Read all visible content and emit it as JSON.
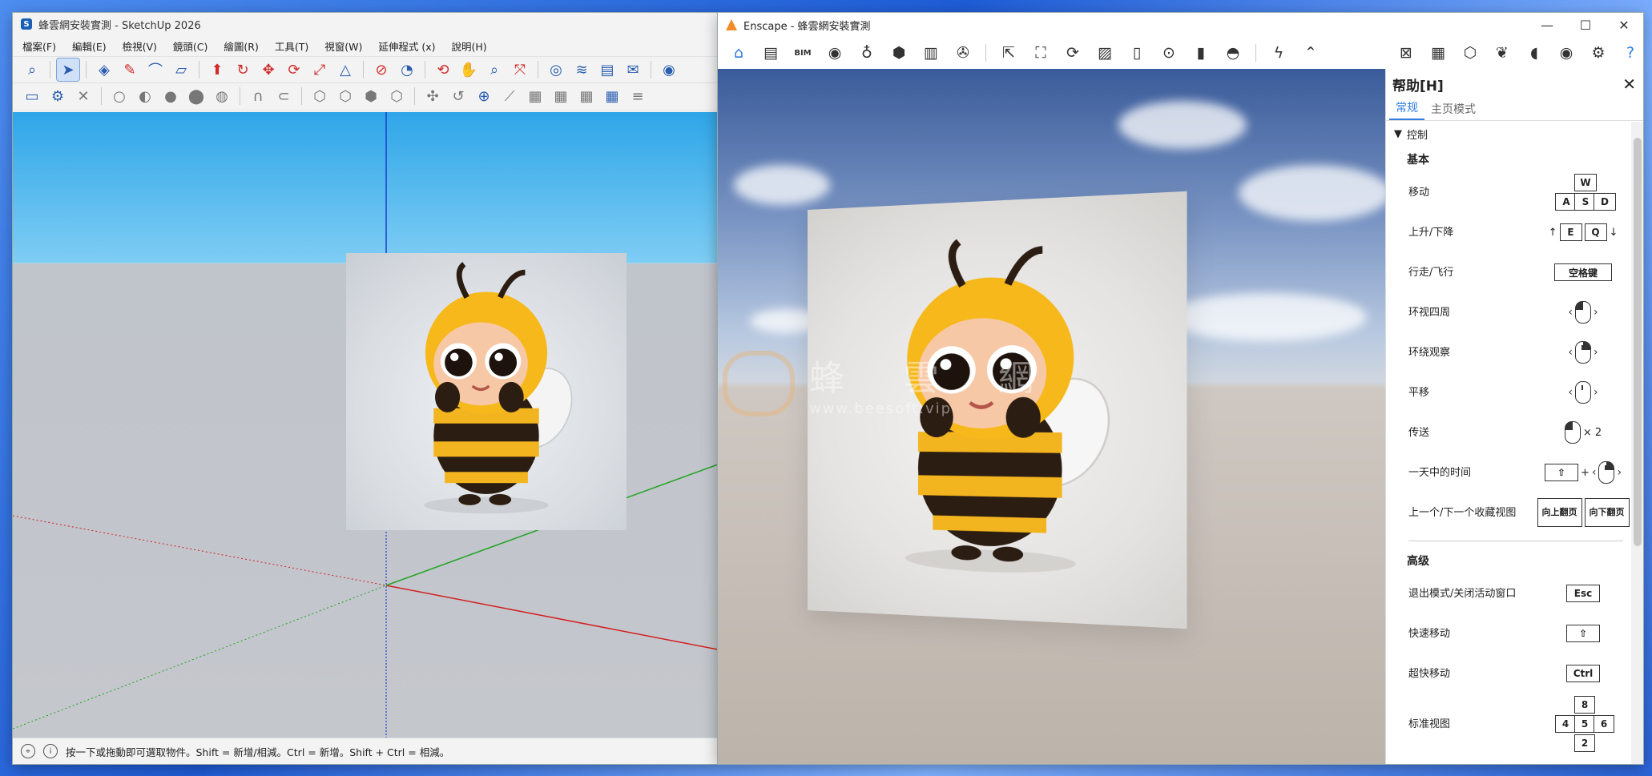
{
  "sketchup": {
    "title": "蜂雲網安裝實測 - SketchUp 2026",
    "menu": [
      "檔案(F)",
      "編輯(E)",
      "檢視(V)",
      "鏡頭(C)",
      "繪圖(R)",
      "工具(T)",
      "視窗(W)",
      "延伸程式 (x)",
      "說明(H)"
    ],
    "status_text": "按一下或拖動即可選取物件。Shift = 新增/相減。Ctrl = 新增。Shift + Ctrl = 相減。",
    "icons": {
      "geo": "location-icon",
      "info": "info-icon"
    }
  },
  "enscape": {
    "title": "Enscape - 蜂雲網安裝實測",
    "bim_label": "BIM",
    "watermark": {
      "text": "蜂 雲 網",
      "url": "www.beesoft.vip"
    },
    "help": {
      "title": "帮助[H]",
      "tabs": [
        "常规",
        "主页模式"
      ],
      "group": "控制",
      "basic_title": "基本",
      "basic": [
        {
          "label": "移动",
          "keys": [
            "W",
            "A",
            "S",
            "D"
          ]
        },
        {
          "label": "上升/下降",
          "keys": [
            "E",
            "Q"
          ]
        },
        {
          "label": "行走/飞行",
          "key": "空格键"
        },
        {
          "label": "环视四周"
        },
        {
          "label": "环绕观察"
        },
        {
          "label": "平移"
        },
        {
          "label": "传送",
          "suffix": "× 2"
        },
        {
          "label": "一天中的时间",
          "plus": "+"
        },
        {
          "label": "上一个/下一个收藏视图",
          "keys": [
            "向上翻页",
            "向下翻页"
          ]
        }
      ],
      "advanced_title": "高级",
      "advanced": [
        {
          "label": "退出模式/关闭活动窗口",
          "key": "Esc"
        },
        {
          "label": "快速移动",
          "key": "⇧"
        },
        {
          "label": "超快移动",
          "key": "Ctrl"
        },
        {
          "label": "标准视图",
          "keys": [
            "8",
            "4",
            "5",
            "6",
            "2"
          ]
        }
      ]
    }
  }
}
